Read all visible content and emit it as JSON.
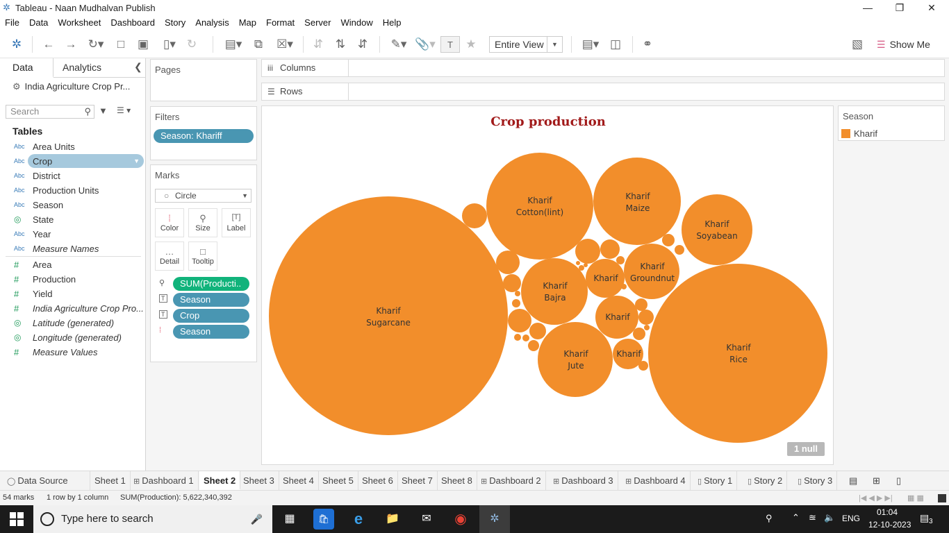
{
  "window": {
    "title": "Tableau - Naan Mudhalvan Publish"
  },
  "menu": [
    "File",
    "Data",
    "Worksheet",
    "Dashboard",
    "Story",
    "Analysis",
    "Map",
    "Format",
    "Server",
    "Window",
    "Help"
  ],
  "toolbar": {
    "fit": "Entire View",
    "show_me": "Show Me"
  },
  "data_pane": {
    "tab_data": "Data",
    "tab_analytics": "Analytics",
    "datasource": "India Agriculture Crop Pr...",
    "search_placeholder": "Search",
    "tables_heading": "Tables",
    "fields": [
      {
        "type": "Abc",
        "name": "Area Units"
      },
      {
        "type": "Abc",
        "name": "Crop"
      },
      {
        "type": "Abc",
        "name": "District"
      },
      {
        "type": "Abc",
        "name": "Production Units"
      },
      {
        "type": "Abc",
        "name": "Season"
      },
      {
        "type": "geo",
        "name": "State"
      },
      {
        "type": "Abc",
        "name": "Year"
      },
      {
        "type": "Abc",
        "name": "Measure Names"
      },
      {
        "type": "#",
        "name": "Area"
      },
      {
        "type": "#",
        "name": "Production"
      },
      {
        "type": "#",
        "name": "Yield"
      },
      {
        "type": "#",
        "name": "India Agriculture Crop Pro..."
      },
      {
        "type": "geo",
        "name": "Latitude (generated)"
      },
      {
        "type": "geo",
        "name": "Longitude (generated)"
      },
      {
        "type": "#",
        "name": "Measure Values"
      }
    ]
  },
  "pages": {
    "label": "Pages"
  },
  "filters": {
    "label": "Filters",
    "pill": "Season: Khariff"
  },
  "marks": {
    "label": "Marks",
    "type": "Circle",
    "buttons": [
      "Color",
      "Size",
      "Label",
      "Detail",
      "Tooltip"
    ],
    "pills": [
      "SUM(Producti..",
      "Season",
      "Crop",
      "Season"
    ]
  },
  "shelves": {
    "columns": "Columns",
    "rows": "Rows"
  },
  "view": {
    "title": "Crop production",
    "null_badge": "1 null"
  },
  "legend": {
    "title": "Season",
    "item": "Kharif",
    "color": "#f28e2b"
  },
  "bubbles": [
    {
      "season": "Kharif",
      "crop": "Sugarcane"
    },
    {
      "season": "Kharif",
      "crop": "Cotton(lint)"
    },
    {
      "season": "Kharif",
      "crop": "Maize"
    },
    {
      "season": "Kharif",
      "crop": "Soyabean"
    },
    {
      "season": "Kharif",
      "crop": "Bajra"
    },
    {
      "season": "Kharif",
      "crop": "Groundnut"
    },
    {
      "season": "Kharif",
      "crop": "Rice"
    },
    {
      "season": "Kharif",
      "crop": "Jute"
    },
    {
      "season": "Kharif",
      "crop": ""
    },
    {
      "season": "Kharif",
      "crop": ""
    },
    {
      "season": "Kharif",
      "crop": ""
    }
  ],
  "sheet_tabs": [
    "Data Source",
    "Sheet 1",
    "Dashboard 1",
    "Sheet 2",
    "Sheet 3",
    "Sheet 4",
    "Sheet 5",
    "Sheet 6",
    "Sheet 7",
    "Sheet 8",
    "Dashboard 2",
    "Dashboard 3",
    "Dashboard 4",
    "Story 1",
    "Story 2",
    "Story 3"
  ],
  "status": {
    "marks": "54 marks",
    "dims": "1 row by 1 column",
    "sum": "SUM(Production): 5,622,340,392"
  },
  "taskbar": {
    "search": "Type here to search",
    "lang": "ENG",
    "time": "01:04",
    "date": "12-10-2023",
    "notif": "3"
  }
}
